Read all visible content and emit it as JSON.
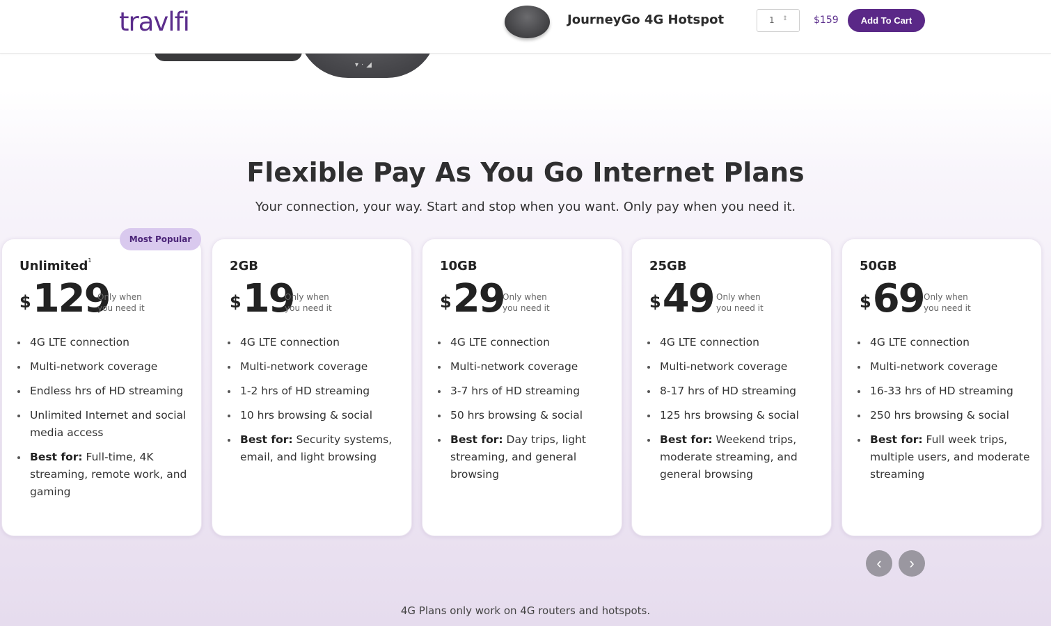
{
  "header": {
    "logo_text": "travlfi",
    "product_name": "JourneyGo 4G Hotspot",
    "quantity": "1",
    "price": "$159",
    "cart_label": "Add To Cart"
  },
  "hero": {
    "headline": "Flexible Pay As You Go Internet Plans",
    "subline": "Your connection, your way. Start and stop when you want. Only pay when you need it."
  },
  "badge": "Most Popular",
  "plans": [
    {
      "name": "Unlimited",
      "name_sup": "1",
      "currency": "$",
      "price": "129",
      "note_1": "Only when",
      "note_2": "you need it",
      "features": [
        "4G LTE connection",
        "Multi-network coverage",
        "Endless hrs of HD streaming",
        "Unlimited Internet and social media access"
      ],
      "best_for_label": "Best for:",
      "best_for": "Full-time, 4K streaming, remote work, and gaming"
    },
    {
      "name": "2GB",
      "currency": "$",
      "price": "19",
      "note_1": "Only when",
      "note_2": "you need it",
      "features": [
        "4G LTE connection",
        "Multi-network coverage",
        "1-2 hrs of HD streaming",
        "10 hrs browsing & social"
      ],
      "best_for_label": "Best for:",
      "best_for": "Security systems, email, and light browsing"
    },
    {
      "name": "10GB",
      "currency": "$",
      "price": "29",
      "note_1": "Only when",
      "note_2": "you need it",
      "features": [
        "4G LTE connection",
        "Multi-network coverage",
        "3-7 hrs of HD streaming",
        "50 hrs browsing & social"
      ],
      "best_for_label": "Best for:",
      "best_for": "Day trips, light streaming, and general browsing"
    },
    {
      "name": "25GB",
      "currency": "$",
      "price": "49",
      "note_1": "Only when",
      "note_2": "you need it",
      "features": [
        "4G LTE connection",
        "Multi-network coverage",
        "8-17 hrs of HD streaming",
        "125 hrs browsing & social"
      ],
      "best_for_label": "Best for:",
      "best_for": "Weekend trips, moderate streaming, and general browsing"
    },
    {
      "name": "50GB",
      "currency": "$",
      "price": "69",
      "note_1": "Only when",
      "note_2": "you need it",
      "features": [
        "4G LTE connection",
        "Multi-network coverage",
        "16-33 hrs of HD streaming",
        "250 hrs browsing & social"
      ],
      "best_for_label": "Best for:",
      "best_for": "Full week trips, multiple users, and moderate streaming"
    }
  ],
  "carousel": {
    "prev_icon": "chevron-left-icon",
    "next_icon": "chevron-right-icon"
  },
  "footnote": "4G Plans only work on 4G routers and hotspots.",
  "colors": {
    "brand": "#5a2887",
    "badge_bg": "#d9c9ee",
    "arrow_bg": "#9a97a0"
  }
}
